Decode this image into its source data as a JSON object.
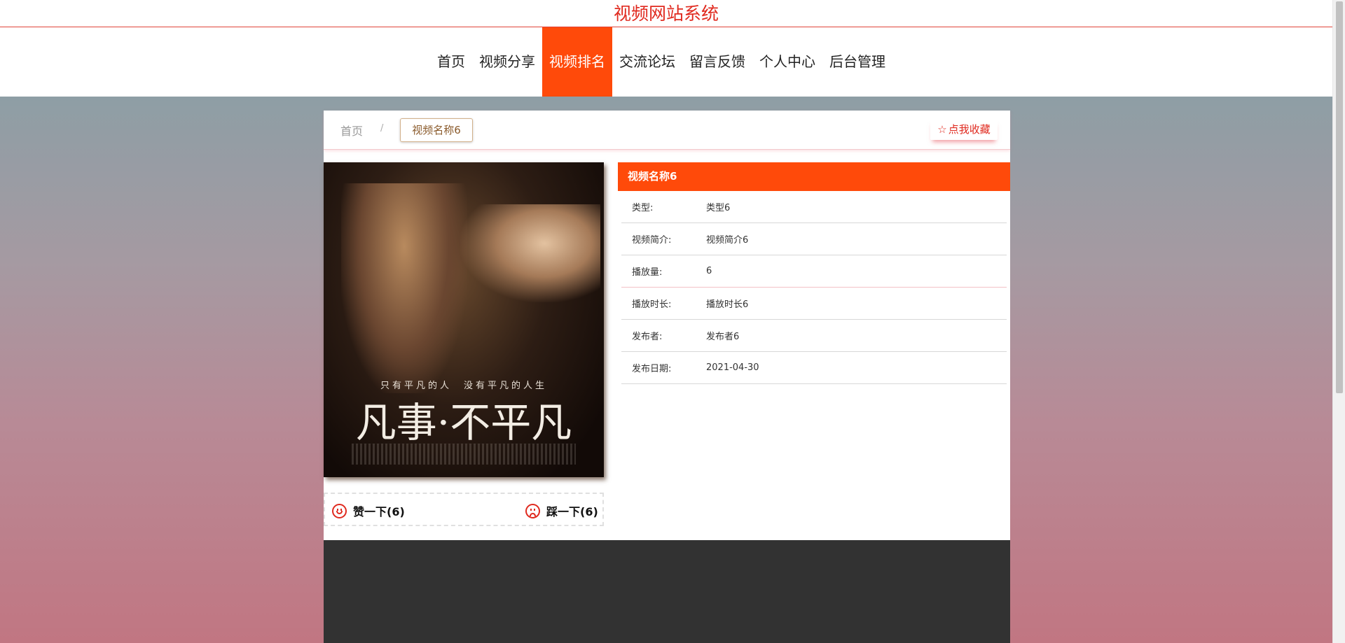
{
  "header": {
    "site_title": "视频网站系统"
  },
  "nav": {
    "items": [
      {
        "label": "首页"
      },
      {
        "label": "视频分享"
      },
      {
        "label": "视频排名",
        "active": true
      },
      {
        "label": "交流论坛"
      },
      {
        "label": "留言反馈"
      },
      {
        "label": "个人中心"
      },
      {
        "label": "后台管理"
      }
    ]
  },
  "breadcrumb": {
    "home": "首页",
    "separator": "/",
    "current": "视频名称6"
  },
  "favorite": {
    "icon": "star-outline-icon",
    "label": "点我收藏"
  },
  "poster": {
    "tagline": "只有平凡的人　没有平凡的人生",
    "title": "凡事·不平凡"
  },
  "votes": {
    "up_label": "赞一下(6)",
    "down_label": "踩一下(6)"
  },
  "detail": {
    "title": "视频名称6",
    "rows": [
      {
        "label": "类型:",
        "value": "类型6"
      },
      {
        "label": "视频简介:",
        "value": "视频简介6"
      },
      {
        "label": "播放量:",
        "value": "6"
      },
      {
        "label": "播放时长:",
        "value": "播放时长6"
      },
      {
        "label": "发布者:",
        "value": "发布者6"
      },
      {
        "label": "发布日期:",
        "value": "2021-04-30"
      }
    ]
  },
  "colors": {
    "accent": "#ff4a0a",
    "title_red": "#e02a1f",
    "footer_dark": "#323232"
  }
}
